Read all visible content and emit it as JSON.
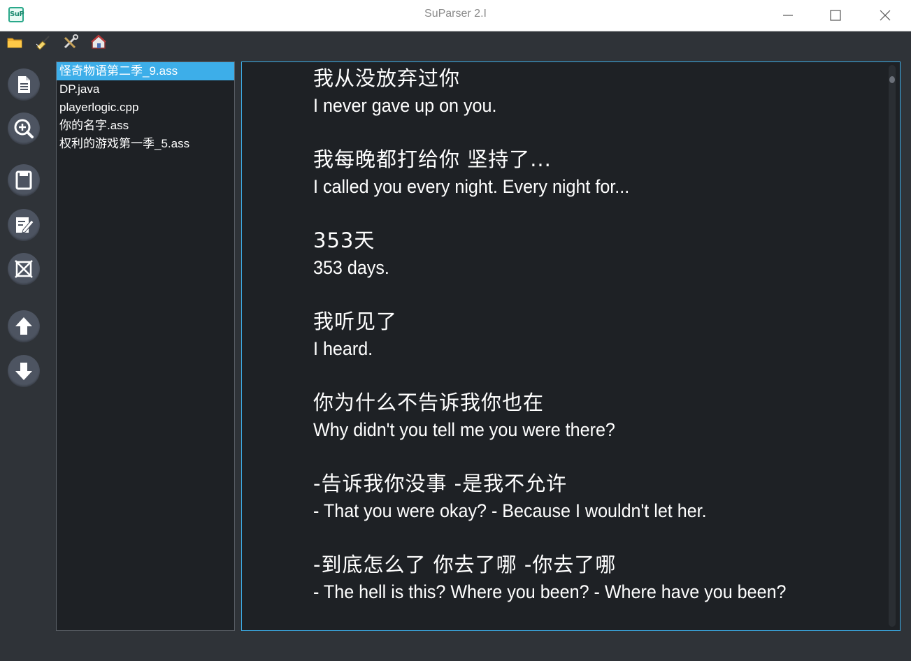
{
  "window": {
    "logo_text": "SuP",
    "title": "SuParser 2.I"
  },
  "menubar": {
    "icons": [
      "folder-icon",
      "clean-brush-icon",
      "tools-icon",
      "home-help-icon"
    ]
  },
  "sidebar": {
    "buttons": [
      "document-icon",
      "zoom-in-icon",
      "save-icon",
      "edit-icon",
      "clear-icon",
      "up-arrow-icon",
      "down-arrow-icon"
    ]
  },
  "files": {
    "items": [
      "怪奇物语第二季_9.ass",
      "DP.java",
      "playerlogic.cpp",
      "你的名字.ass",
      "权利的游戏第一季_5.ass"
    ],
    "selected_index": 0
  },
  "subtitles": [
    {
      "zh": "我从没放弃过你",
      "en": "I never gave up on you."
    },
    {
      "zh": "我每晚都打给你  坚持了...",
      "en": "I called you every night. Every night for..."
    },
    {
      "zh": "353天",
      "en": "353 days."
    },
    {
      "zh": "我听见了",
      "en": "I heard."
    },
    {
      "zh": "你为什么不告诉我你也在",
      "en": "Why didn't you tell me you were there?"
    },
    {
      "zh": "-告诉我你没事  -是我不允许",
      "en": "- That you were okay? - Because I wouldn't let her."
    },
    {
      "zh": "-到底怎么了  你去了哪  -你去了哪",
      "en": "- The hell is this? Where you been? - Where have you been?"
    }
  ],
  "colors": {
    "accent": "#3daee9",
    "background": "#2f3338",
    "panel": "#1e2125"
  }
}
